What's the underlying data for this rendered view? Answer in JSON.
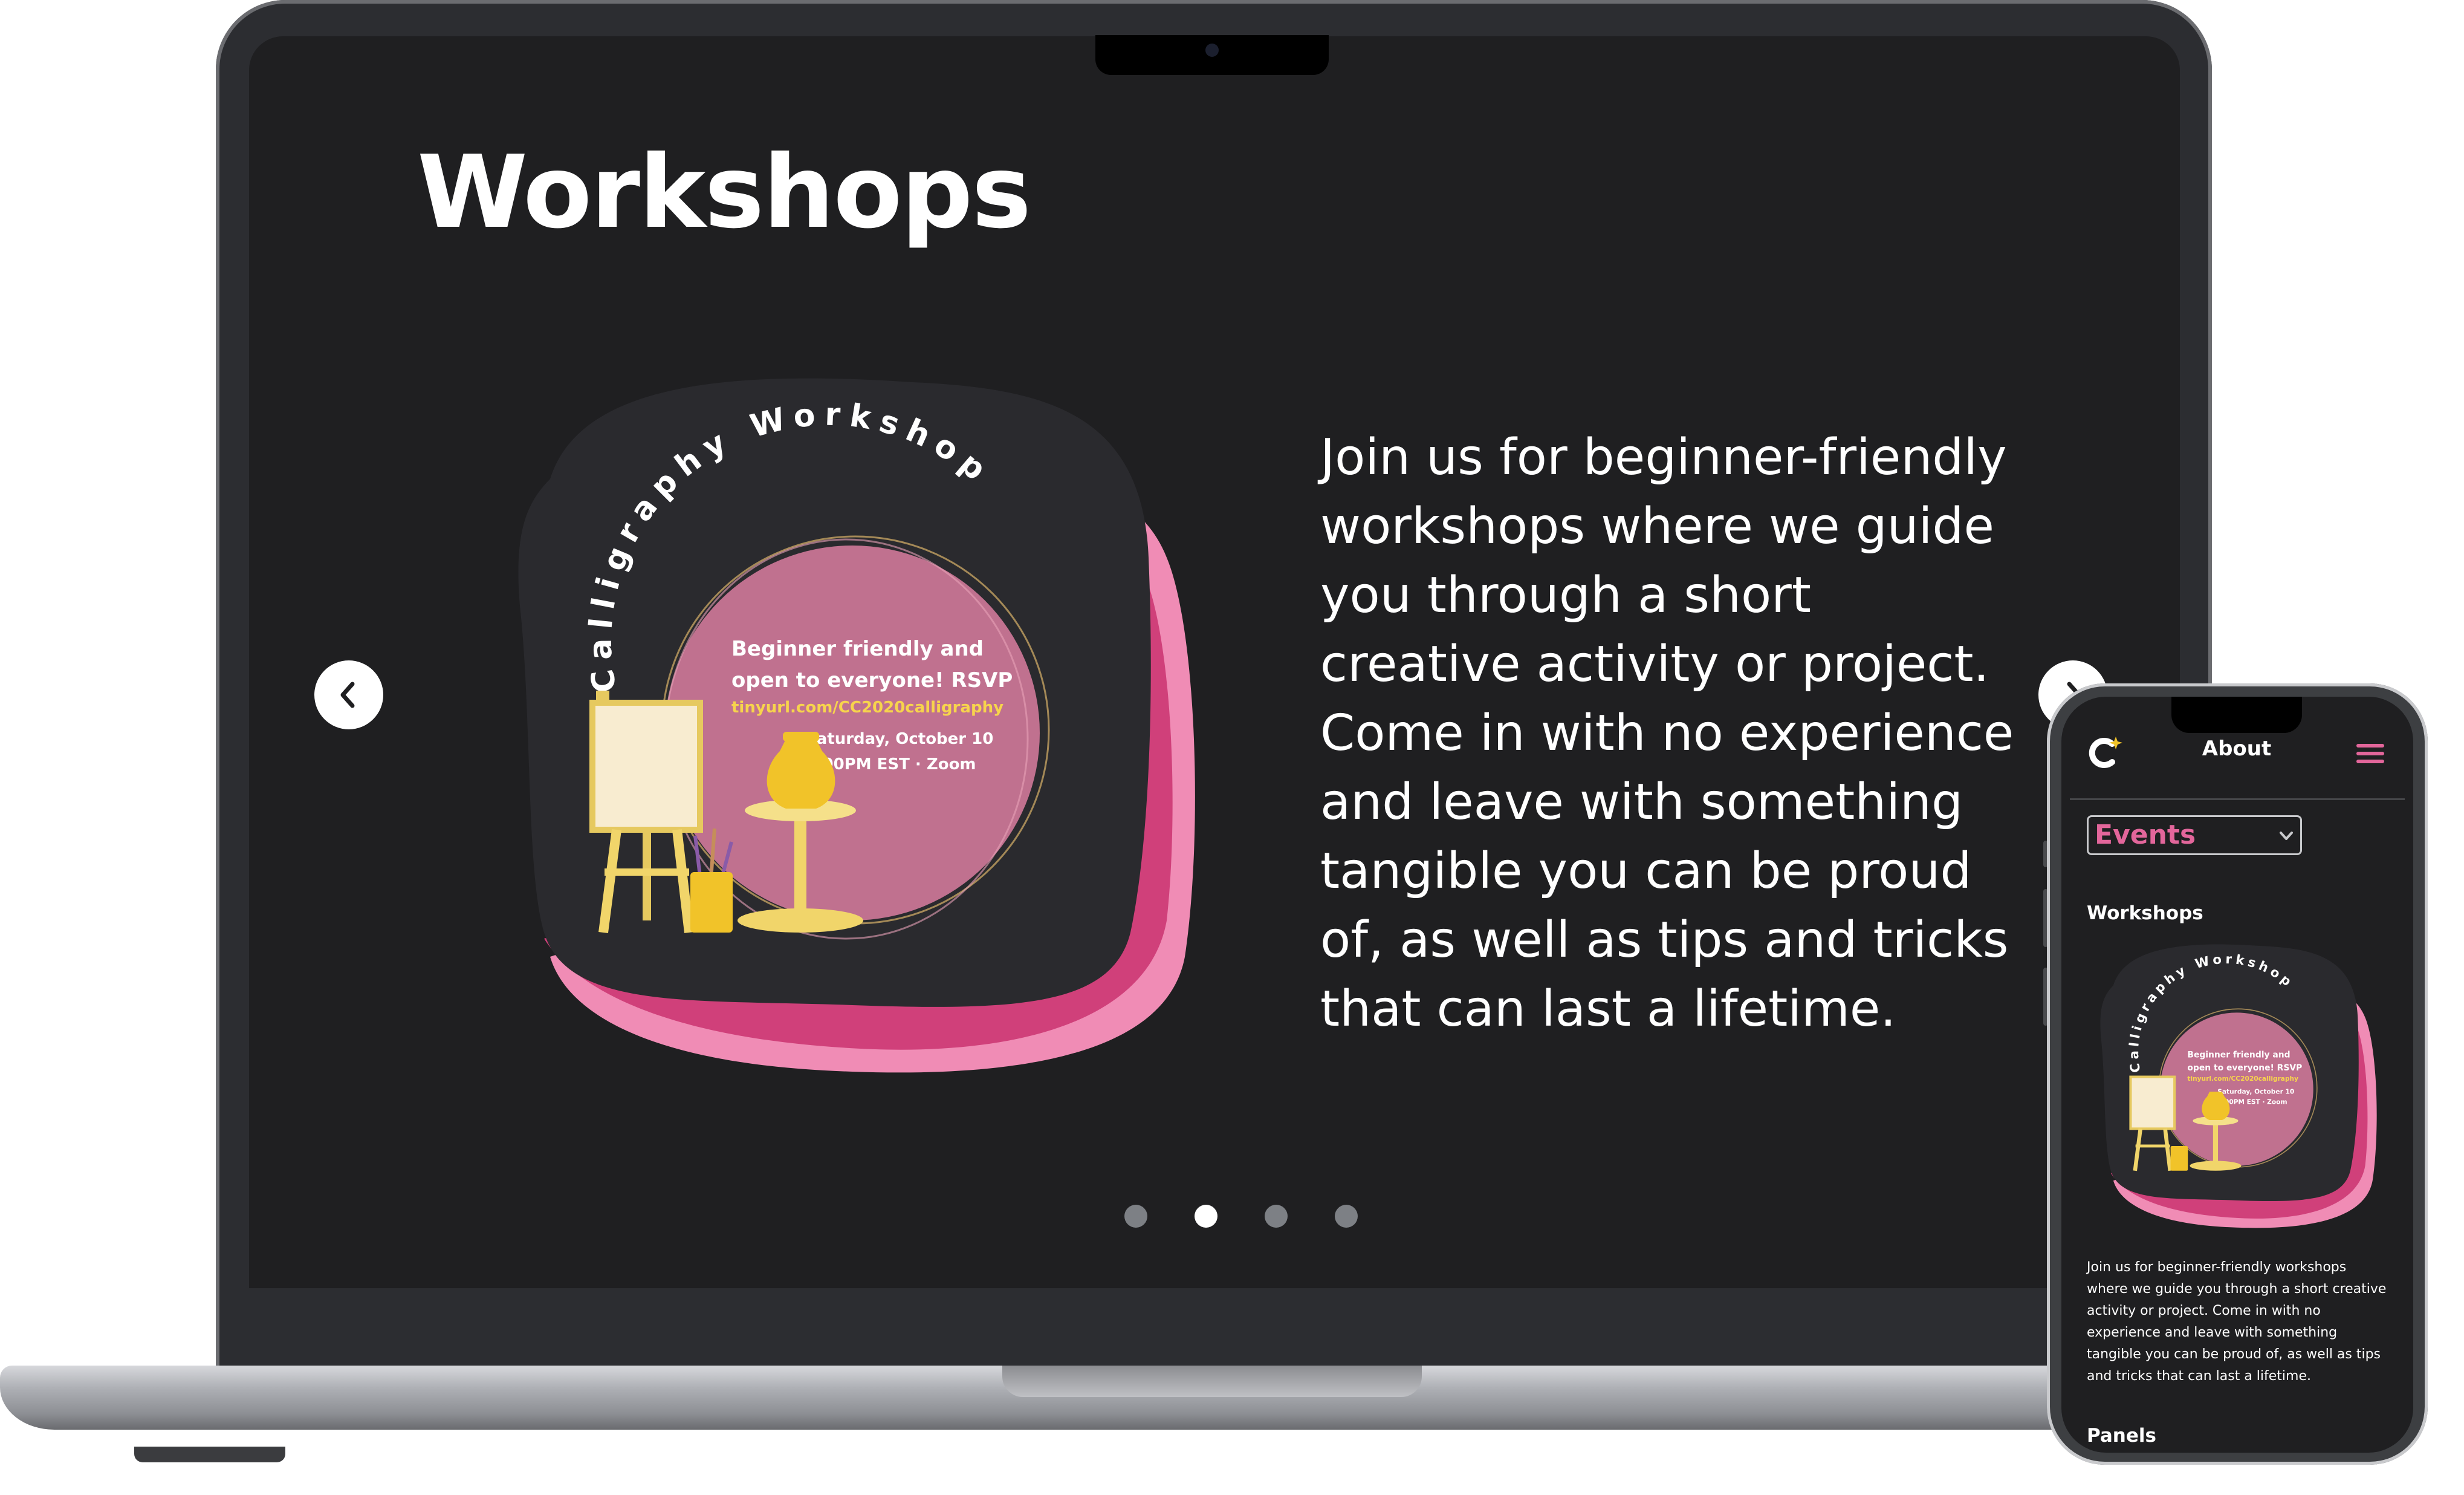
{
  "colors": {
    "screen_bg": "#1f1f21",
    "card_bg": "#2a2a2e",
    "accent_pink": "#e3669b",
    "deep_pink": "#d0407a",
    "circle_pink": "#c0718f",
    "gold": "#f1c329",
    "link_yellow": "#f7d44c"
  },
  "laptop": {
    "page_title": "Workshops",
    "description": "Join us for beginner-friendly workshops where we guide you through a short creative activity or project. Come in with no experience and leave with something tangible you can be proud of, as well as tips and tricks that can last a lifetime.",
    "prev_icon": "chevron-left-icon",
    "next_icon": "chevron-right-icon",
    "carousel": {
      "slide_count": 4,
      "active_index": 1
    },
    "poster": {
      "arc_title": "Calligraphy Workshop",
      "line1": "Beginner friendly and",
      "line2": "open to everyone! RSVP",
      "link": "tinyurl.com/CC2020calligraphy",
      "date": "Saturday, October 10",
      "time": "8:00PM EST · Zoom"
    }
  },
  "phone": {
    "logo_icon": "club-logo-icon",
    "nav_title": "About",
    "menu_icon": "hamburger-menu-icon",
    "dropdown_value": "Events",
    "dropdown_icon": "chevron-down-icon",
    "section_title": "Workshops",
    "description": "Join us for beginner-friendly workshops where we guide you through a short creative activity or project. Come in with no experience and leave with something tangible you can be proud of, as well as tips and tricks that can last a lifetime.",
    "next_section_title": "Panels",
    "poster": {
      "arc_title": "Calligraphy Workshop",
      "line1": "Beginner friendly and",
      "line2": "open to everyone! RSVP",
      "link": "tinyurl.com/CC2020calligraphy",
      "date": "Saturday, October 10",
      "time": "8:00PM EST · Zoom"
    }
  }
}
